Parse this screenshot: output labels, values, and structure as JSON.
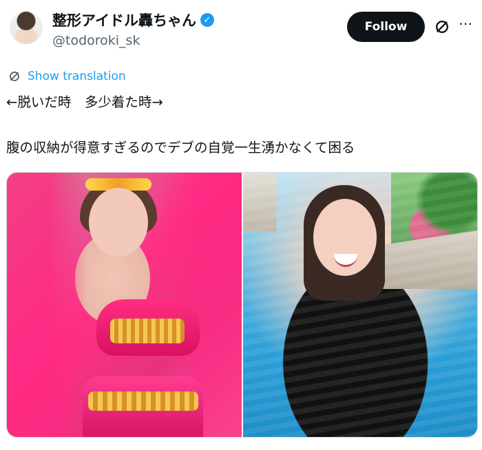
{
  "profile": {
    "display_name": "整形アイドル轟ちゃん",
    "handle": "@todoroki_sk",
    "verified_symbol": "✓"
  },
  "actions": {
    "follow_label": "Follow",
    "more_label": "⋯"
  },
  "translation": {
    "label": "Show translation"
  },
  "post": {
    "line1": "←脱いだ時　多少着た時→",
    "line2": "腹の収納が得意すぎるのでデブの自覚一生湧かなくて困る"
  },
  "colors": {
    "accent": "#1d9bf0",
    "text": "#0f1419",
    "muted": "#536471",
    "follow_bg": "#0f1419"
  }
}
